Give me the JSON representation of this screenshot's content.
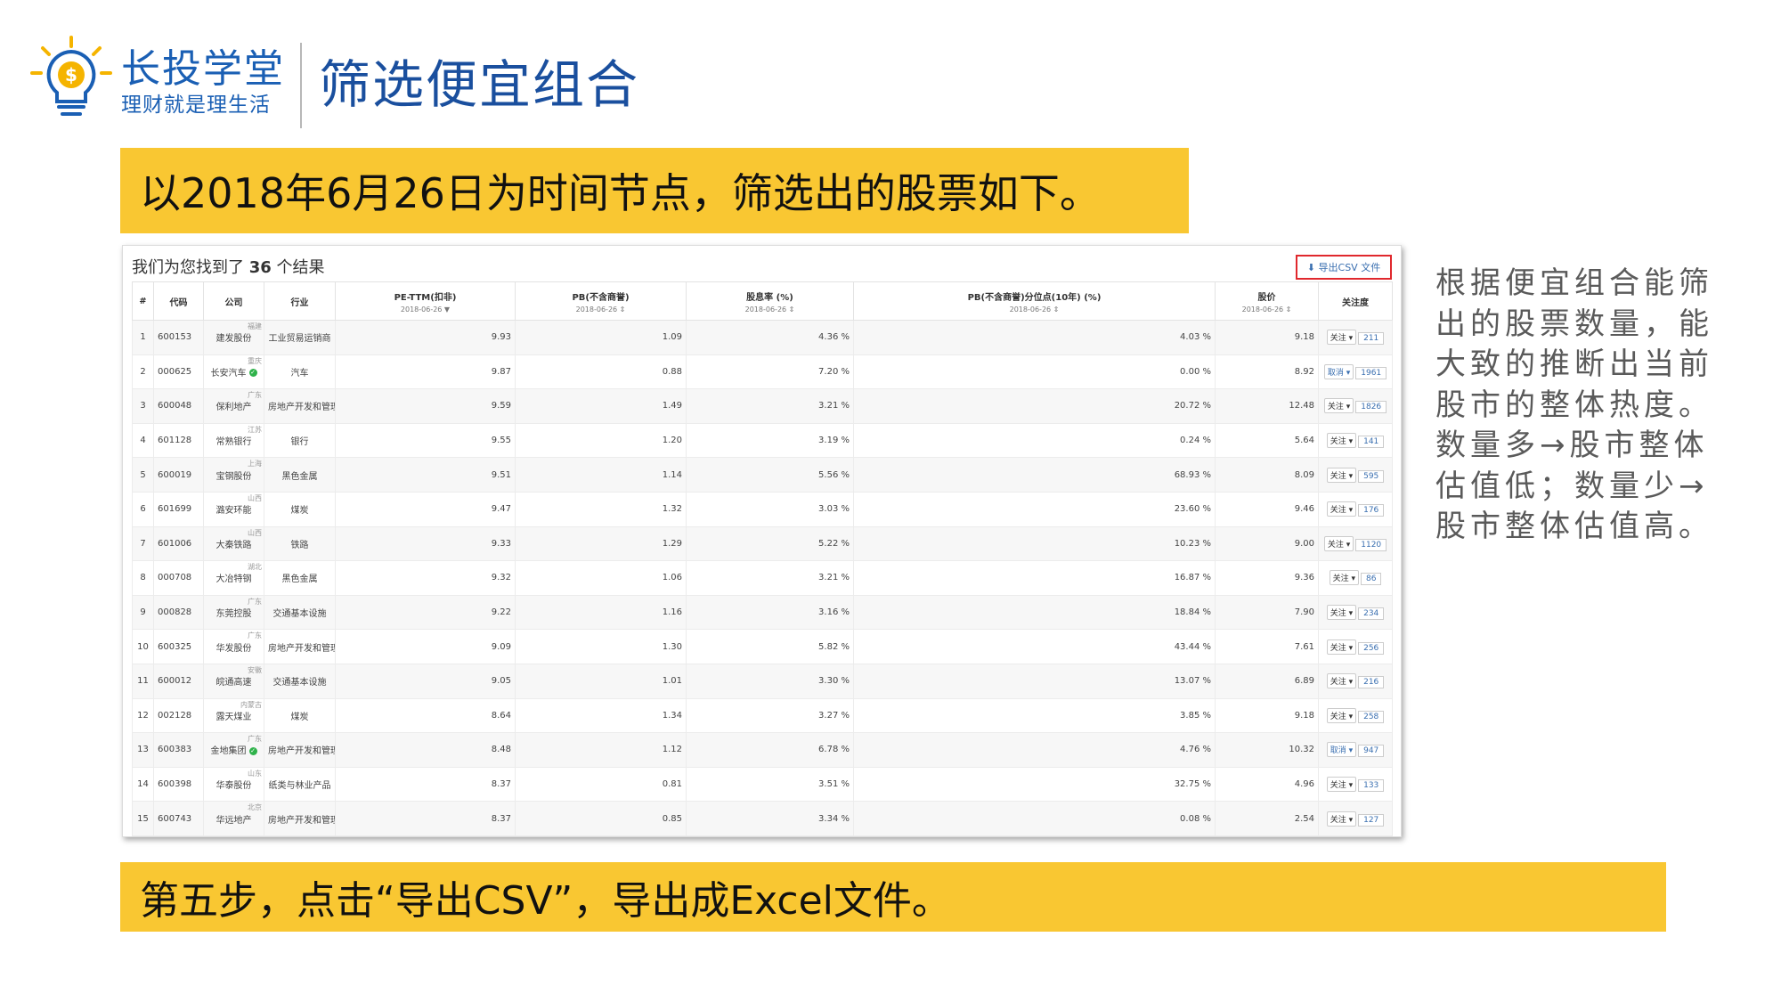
{
  "brand": {
    "name": "长投学堂",
    "slogan": "理财就是理生活",
    "logo_icon": "lightbulb-dollar-icon",
    "colors": {
      "brand": "#1a5fb4",
      "banner": "#f9c732"
    }
  },
  "page_title": "筛选便宜组合",
  "banner_top": "以2018年6月26日为时间节点，筛选出的股票如下。",
  "banner_bottom": "第五步，点击“导出CSV”，导出成Excel文件。",
  "side_note": "根据便宜组合能筛出的股票数量，能大致的推断出当前股市的整体热度。数量多→股市整体估值低；数量少→股市整体估值高。",
  "screenshot": {
    "result_prefix": "我们为您找到了",
    "result_count": "36",
    "result_suffix": "个结果",
    "export_label": "导出CSV 文件",
    "columns": {
      "index": "#",
      "code": "代码",
      "company": "公司",
      "industry": "行业",
      "pe": "PE-TTM(扣非)",
      "pe_date": "2018-06-26",
      "pb": "PB(不含商誉)",
      "pb_date": "2018-06-26",
      "dividend": "股息率 (%)",
      "dividend_date": "2018-06-26",
      "pb_pct": "PB(不含商誉)分位点(10年) (%)",
      "pb_pct_date": "2018-06-26",
      "price": "股价",
      "price_date": "2018-06-26",
      "follow": "关注度"
    },
    "rows": [
      {
        "idx": "1",
        "code": "600153",
        "company": "建发股份",
        "region": "福建",
        "industry": "工业贸易运销商",
        "pe": "9.93",
        "pb": "1.09",
        "div": "4.36 %",
        "pbpct": "4.03 %",
        "price": "9.18",
        "btn": "关注",
        "count": "211"
      },
      {
        "idx": "2",
        "code": "000625",
        "company": "长安汽车",
        "region": "重庆",
        "industry": "汽车",
        "pe": "9.87",
        "pb": "0.88",
        "div": "7.20 %",
        "pbpct": "0.00 %",
        "price": "8.92",
        "btn": "取消",
        "count": "1961"
      },
      {
        "idx": "3",
        "code": "600048",
        "company": "保利地产",
        "region": "广东",
        "industry": "房地产开发和管理",
        "pe": "9.59",
        "pb": "1.49",
        "div": "3.21 %",
        "pbpct": "20.72 %",
        "price": "12.48",
        "btn": "关注",
        "count": "1826"
      },
      {
        "idx": "4",
        "code": "601128",
        "company": "常熟银行",
        "region": "江苏",
        "industry": "银行",
        "pe": "9.55",
        "pb": "1.20",
        "div": "3.19 %",
        "pbpct": "0.24 %",
        "price": "5.64",
        "btn": "关注",
        "count": "141"
      },
      {
        "idx": "5",
        "code": "600019",
        "company": "宝钢股份",
        "region": "上海",
        "industry": "黑色金属",
        "pe": "9.51",
        "pb": "1.14",
        "div": "5.56 %",
        "pbpct": "68.93 %",
        "price": "8.09",
        "btn": "关注",
        "count": "595"
      },
      {
        "idx": "6",
        "code": "601699",
        "company": "潞安环能",
        "region": "山西",
        "industry": "煤炭",
        "pe": "9.47",
        "pb": "1.32",
        "div": "3.03 %",
        "pbpct": "23.60 %",
        "price": "9.46",
        "btn": "关注",
        "count": "176"
      },
      {
        "idx": "7",
        "code": "601006",
        "company": "大秦铁路",
        "region": "山西",
        "industry": "铁路",
        "pe": "9.33",
        "pb": "1.29",
        "div": "5.22 %",
        "pbpct": "10.23 %",
        "price": "9.00",
        "btn": "关注",
        "count": "1120"
      },
      {
        "idx": "8",
        "code": "000708",
        "company": "大冶特钢",
        "region": "湖北",
        "industry": "黑色金属",
        "pe": "9.32",
        "pb": "1.06",
        "div": "3.21 %",
        "pbpct": "16.87 %",
        "price": "9.36",
        "btn": "关注",
        "count": "86"
      },
      {
        "idx": "9",
        "code": "000828",
        "company": "东莞控股",
        "region": "广东",
        "industry": "交通基本设施",
        "pe": "9.22",
        "pb": "1.16",
        "div": "3.16 %",
        "pbpct": "18.84 %",
        "price": "7.90",
        "btn": "关注",
        "count": "234"
      },
      {
        "idx": "10",
        "code": "600325",
        "company": "华发股份",
        "region": "广东",
        "industry": "房地产开发和管理",
        "pe": "9.09",
        "pb": "1.30",
        "div": "5.82 %",
        "pbpct": "43.44 %",
        "price": "7.61",
        "btn": "关注",
        "count": "256"
      },
      {
        "idx": "11",
        "code": "600012",
        "company": "皖通高速",
        "region": "安徽",
        "industry": "交通基本设施",
        "pe": "9.05",
        "pb": "1.01",
        "div": "3.30 %",
        "pbpct": "13.07 %",
        "price": "6.89",
        "btn": "关注",
        "count": "216"
      },
      {
        "idx": "12",
        "code": "002128",
        "company": "露天煤业",
        "region": "内蒙古",
        "industry": "煤炭",
        "pe": "8.64",
        "pb": "1.34",
        "div": "3.27 %",
        "pbpct": "3.85 %",
        "price": "9.18",
        "btn": "关注",
        "count": "258"
      },
      {
        "idx": "13",
        "code": "600383",
        "company": "金地集团",
        "region": "广东",
        "industry": "房地产开发和管理",
        "pe": "8.48",
        "pb": "1.12",
        "div": "6.78 %",
        "pbpct": "4.76 %",
        "price": "10.32",
        "btn": "取消",
        "count": "947"
      },
      {
        "idx": "14",
        "code": "600398",
        "company": "华泰股份",
        "region": "山东",
        "industry": "纸类与林业产品",
        "pe": "8.37",
        "pb": "0.81",
        "div": "3.51 %",
        "pbpct": "32.75 %",
        "price": "4.96",
        "btn": "关注",
        "count": "133"
      },
      {
        "idx": "15",
        "code": "600743",
        "company": "华远地产",
        "region": "北京",
        "industry": "房地产开发和管理",
        "pe": "8.37",
        "pb": "0.85",
        "div": "3.34 %",
        "pbpct": "0.08 %",
        "price": "2.54",
        "btn": "关注",
        "count": "127"
      }
    ],
    "verified_rows": [
      "2",
      "13"
    ]
  }
}
